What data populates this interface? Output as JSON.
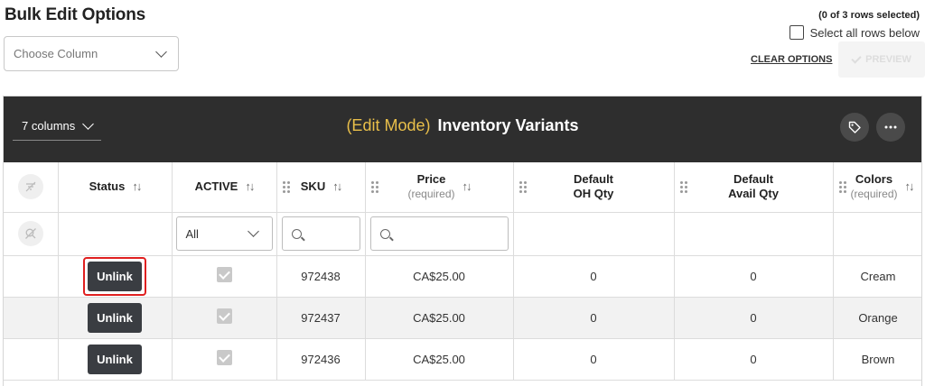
{
  "page": {
    "title": "Bulk Edit Options",
    "choose_column_placeholder": "Choose Column",
    "selection_info": "(0 of 3 rows selected)",
    "select_all_label": "Select all rows below",
    "clear_options": "CLEAR OPTIONS",
    "preview_label": "PREVIEW"
  },
  "grid": {
    "column_count": "7 columns",
    "mode_label": "(Edit Mode)",
    "title": "Inventory Variants",
    "headers": {
      "status": "Status",
      "active": "ACTIVE",
      "sku": "SKU",
      "price": "Price",
      "price_note": "(required)",
      "oh_qty_1": "Default",
      "oh_qty_2": "OH Qty",
      "avail_qty_1": "Default",
      "avail_qty_2": "Avail Qty",
      "colors": "Colors",
      "colors_note": "(required)"
    },
    "filters": {
      "active_value": "All"
    },
    "rows": [
      {
        "status_button": "Unlink",
        "active": true,
        "sku": "972438",
        "price": "CA$25.00",
        "oh_qty": "0",
        "avail_qty": "0",
        "color": "Cream"
      },
      {
        "status_button": "Unlink",
        "active": true,
        "sku": "972437",
        "price": "CA$25.00",
        "oh_qty": "0",
        "avail_qty": "0",
        "color": "Orange"
      },
      {
        "status_button": "Unlink",
        "active": true,
        "sku": "972436",
        "price": "CA$25.00",
        "oh_qty": "0",
        "avail_qty": "0",
        "color": "Brown"
      }
    ]
  },
  "icons": {
    "sort": "sort-icon",
    "tag": "tag-icon",
    "more": "more-icon",
    "search": "search-icon",
    "grip": "drag-handle-icon"
  },
  "colors": {
    "header_bg": "#2e2e2e",
    "mode_accent": "#e9bf4a",
    "highlight": "#e02020",
    "button_bg": "#3a3d42"
  }
}
